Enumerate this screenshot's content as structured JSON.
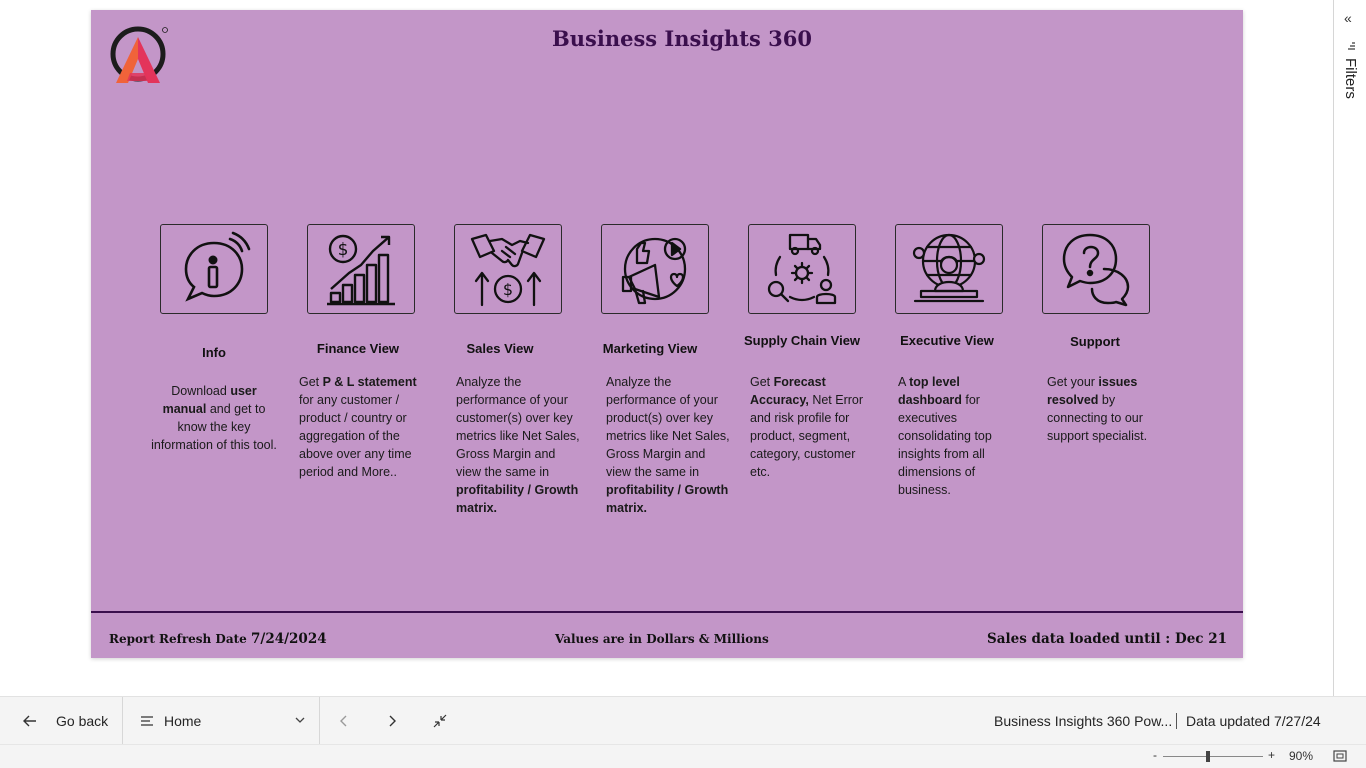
{
  "report": {
    "title": "Business Insights 360",
    "tiles": [
      {
        "id": "info",
        "title": "Info",
        "icon": "info-icon",
        "desc": [
          {
            "t": "Download "
          },
          {
            "t": "user manual",
            "b": true
          },
          {
            "t": " and get to know the key information of this tool."
          }
        ]
      },
      {
        "id": "finance",
        "title": "Finance View",
        "icon": "finance-growth-icon",
        "desc": [
          {
            "t": "Get  "
          },
          {
            "t": "P & L statement",
            "b": true
          },
          {
            "t": " for any customer / product / country or aggregation of the above over any time period and More.."
          }
        ]
      },
      {
        "id": "sales",
        "title": "Sales View",
        "icon": "handshake-icon",
        "desc": [
          {
            "t": "Analyze the performance of your customer(s) over key metrics like Net Sales, Gross Margin and view the same in "
          },
          {
            "t": "profitability / Growth matrix.",
            "b": true
          }
        ]
      },
      {
        "id": "marketing",
        "title": "Marketing View",
        "icon": "megaphone-icon",
        "desc": [
          {
            "t": "Analyze the performance of your product(s) over key metrics like Net Sales, Gross Margin and view the same in "
          },
          {
            "t": "profitability / Growth matrix.",
            "b": true
          }
        ]
      },
      {
        "id": "supply",
        "title": "Supply Chain View",
        "icon": "supply-chain-icon",
        "desc": [
          {
            "t": "Get "
          },
          {
            "t": "Forecast Accuracy,",
            "b": true
          },
          {
            "t": " Net Error and risk profile for product, segment, category, customer etc."
          }
        ]
      },
      {
        "id": "executive",
        "title": "Executive View",
        "icon": "executive-globe-icon",
        "desc": [
          {
            "t": "A "
          },
          {
            "t": "top level dashboard",
            "b": true
          },
          {
            "t": " for executives consolidating top insights from all dimensions of business."
          }
        ]
      },
      {
        "id": "support",
        "title": "Support",
        "icon": "support-chat-icon",
        "desc": [
          {
            "t": "Get your "
          },
          {
            "t": "issues resolved",
            "b": true
          },
          {
            "t": " by connecting to our support specialist."
          }
        ]
      }
    ],
    "footer": {
      "refresh_label": "Report Refresh Date",
      "refresh_value": "7/24/2024",
      "units_note": "Values are in Dollars & Millions",
      "sales_loaded": "Sales data loaded until : Dec 21"
    }
  },
  "filters_pane": {
    "label": "Filters",
    "collapse_icon": "chevron-double-left-icon",
    "filter_icon": "filter-icon"
  },
  "navbar": {
    "back_label": "Go back",
    "page_selector": "Home",
    "report_name": "Business Insights 360 Pow...",
    "data_updated": "Data updated 7/27/24"
  },
  "statusbar": {
    "zoom_minus": "-",
    "zoom_plus": "+",
    "zoom_level": "90%",
    "zoom_fraction": 0.45
  },
  "colors": {
    "canvas_bg": "#c396c8",
    "title": "#3a0f4d",
    "footer_line": "#3a0f4d",
    "logo_dark": "#1c1c1c",
    "logo_orange": "#f0633a",
    "logo_pink": "#e3345b"
  }
}
